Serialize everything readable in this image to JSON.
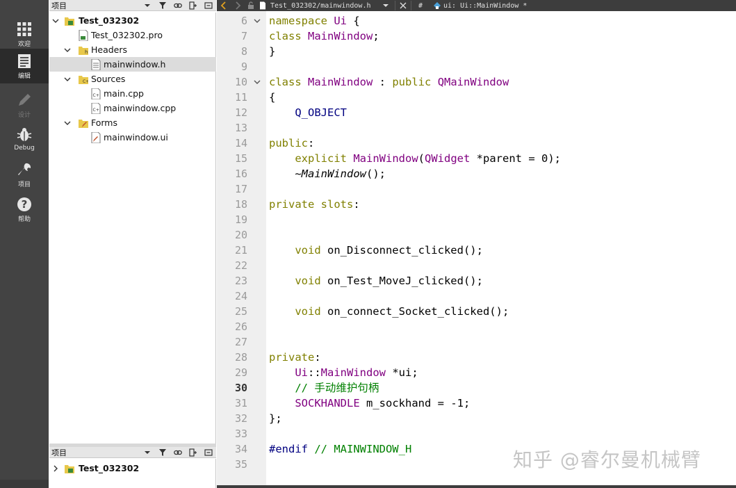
{
  "modebar": {
    "items": [
      {
        "label": "欢迎",
        "icon": "grid-icon"
      },
      {
        "label": "编辑",
        "icon": "edit-document-icon"
      },
      {
        "label": "设计",
        "icon": "pencil-icon"
      },
      {
        "label": "Debug",
        "icon": "bug-icon"
      },
      {
        "label": "项目",
        "icon": "wrench-icon"
      },
      {
        "label": "帮助",
        "icon": "help-icon"
      }
    ]
  },
  "project_panel": {
    "title": "项目",
    "tree": [
      {
        "label": "Test_032302",
        "bold": true
      },
      {
        "label": "Test_032302.pro"
      },
      {
        "label": "Headers"
      },
      {
        "label": "mainwindow.h"
      },
      {
        "label": "Sources"
      },
      {
        "label": "main.cpp"
      },
      {
        "label": "mainwindow.cpp"
      },
      {
        "label": "Forms"
      },
      {
        "label": "mainwindow.ui"
      }
    ]
  },
  "project_panel_bottom": {
    "title": "项目",
    "tree": [
      {
        "label": "Test_032302",
        "bold": true
      }
    ]
  },
  "editor_toolbar": {
    "file_path": "Test_032302/mainwindow.h",
    "hash": "#",
    "symbol": "ui: Ui::MainWindow *"
  },
  "editor": {
    "current_line": 30,
    "lines": [
      {
        "n": "6",
        "text": "namespace Ui {"
      },
      {
        "n": "7",
        "text": "class MainWindow;"
      },
      {
        "n": "8",
        "text": "}"
      },
      {
        "n": "9",
        "text": ""
      },
      {
        "n": "10",
        "text": "class MainWindow : public QMainWindow"
      },
      {
        "n": "11",
        "text": "{"
      },
      {
        "n": "12",
        "text": "    Q_OBJECT"
      },
      {
        "n": "13",
        "text": ""
      },
      {
        "n": "14",
        "text": "public:"
      },
      {
        "n": "15",
        "text": "    explicit MainWindow(QWidget *parent = 0);"
      },
      {
        "n": "16",
        "text": "    ~MainWindow();"
      },
      {
        "n": "17",
        "text": ""
      },
      {
        "n": "18",
        "text": "private slots:"
      },
      {
        "n": "19",
        "text": ""
      },
      {
        "n": "20",
        "text": ""
      },
      {
        "n": "21",
        "text": "    void on_Disconnect_clicked();"
      },
      {
        "n": "22",
        "text": ""
      },
      {
        "n": "23",
        "text": "    void on_Test_MoveJ_clicked();"
      },
      {
        "n": "24",
        "text": ""
      },
      {
        "n": "25",
        "text": "    void on_connect_Socket_clicked();"
      },
      {
        "n": "26",
        "text": ""
      },
      {
        "n": "27",
        "text": ""
      },
      {
        "n": "28",
        "text": "private:"
      },
      {
        "n": "29",
        "text": "    Ui::MainWindow *ui;"
      },
      {
        "n": "30",
        "text": "    // 手动维护句柄"
      },
      {
        "n": "31",
        "text": "    SOCKHANDLE m_sockhand = -1;"
      },
      {
        "n": "32",
        "text": "};"
      },
      {
        "n": "33",
        "text": ""
      },
      {
        "n": "34",
        "text": "#endif // MAINWINDOW_H"
      },
      {
        "n": "35",
        "text": ""
      }
    ]
  },
  "watermark": "知乎 @睿尔曼机械臂",
  "colors": {
    "keyword": "#808000",
    "type": "#800080",
    "macro": "#000080",
    "comment": "#008000",
    "change_marker": "#2aa02a"
  }
}
